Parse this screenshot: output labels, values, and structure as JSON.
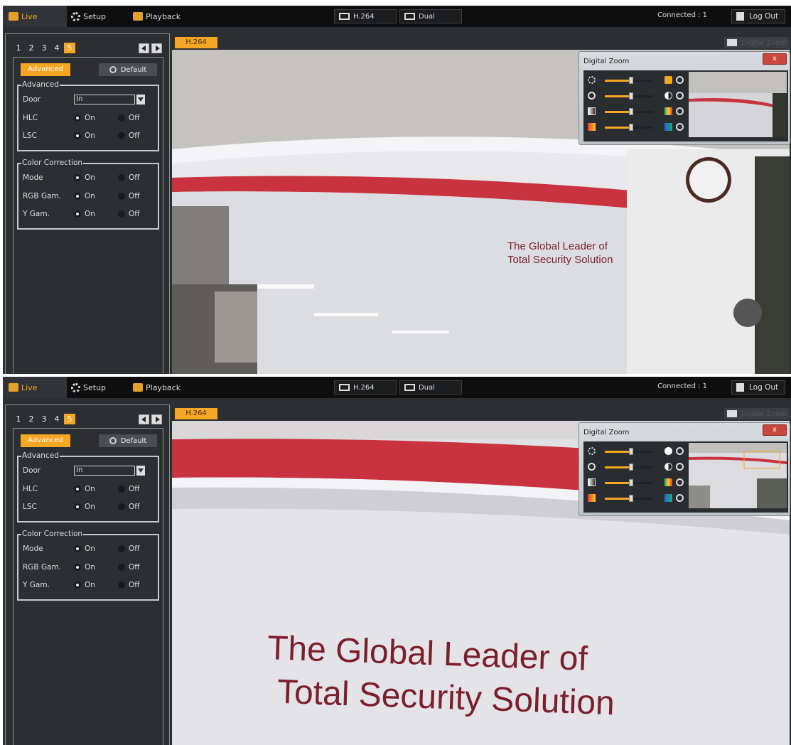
{
  "screens": [
    {
      "nav": {
        "live": "Live",
        "setup": "Setup",
        "playback": "Playback"
      },
      "toolbar": {
        "codec": "H.264",
        "dual": "Dual",
        "connected": "Connected : 1",
        "logout": "Log Out"
      },
      "channels": [
        "1",
        "2",
        "3",
        "4",
        "5"
      ],
      "selected_channel": "5",
      "panel": {
        "advanced_button": "Advanced",
        "default_button": "Default",
        "advanced_group": "Advanced",
        "door_label": "Door",
        "door_value": "In",
        "hlc_label": "HLC",
        "lsc_label": "LSC",
        "color_group": "Color Correction",
        "mode_label": "Mode",
        "rgb_label": "RGB Gam.",
        "ygam_label": "Y Gam.",
        "on": "On",
        "off": "Off"
      },
      "video_tab": "H.264",
      "digital_zoom_tab": "Digital Zoom",
      "digital_zoom_window": {
        "title": "Digital Zoom",
        "close": "x"
      },
      "watermark": {
        "line1": "The Global Leader of",
        "line2": "Total Security Solution"
      }
    },
    {
      "nav": {
        "live": "Live",
        "setup": "Setup",
        "playback": "Playback"
      },
      "toolbar": {
        "codec": "H.264",
        "dual": "Dual",
        "connected": "Connected : 1",
        "logout": "Log Out"
      },
      "channels": [
        "1",
        "2",
        "3",
        "4",
        "5"
      ],
      "selected_channel": "5",
      "panel": {
        "advanced_button": "Advanced",
        "default_button": "Default",
        "advanced_group": "Advanced",
        "door_label": "Door",
        "door_value": "In",
        "hlc_label": "HLC",
        "lsc_label": "LSC",
        "color_group": "Color Correction",
        "mode_label": "Mode",
        "rgb_label": "RGB Gam.",
        "ygam_label": "Y Gam.",
        "on": "On",
        "off": "Off"
      },
      "video_tab": "H.264",
      "digital_zoom_tab": "Digital Zoom",
      "digital_zoom_window": {
        "title": "Digital Zoom",
        "close": "x"
      },
      "watermark": {
        "line1": "The Global Leader of",
        "line2": "Total Security Solution"
      }
    }
  ],
  "colors": {
    "accent": "#f5a623",
    "panel_bg": "#2c2f32",
    "topbar_bg": "#0e0e0f",
    "wall_stripe": "#c9333f"
  }
}
